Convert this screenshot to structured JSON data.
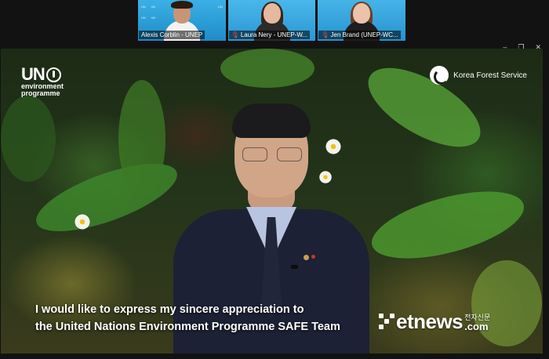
{
  "participants": [
    {
      "name": "Alexis Corblin - UNEP",
      "mic_muted": false
    },
    {
      "name": "Laura Nery - UNEP-W...",
      "mic_muted": true
    },
    {
      "name": "Jen Brand (UNEP-WC...",
      "mic_muted": true
    }
  ],
  "window_controls": {
    "minimize": "–",
    "restore": "❐",
    "close": "✕"
  },
  "video": {
    "logo_left": {
      "main": "UN",
      "line1": "environment",
      "line2": "programme"
    },
    "logo_right": "Korea Forest Service",
    "subtitle_line1": "I would like to express my sincere appreciation to",
    "subtitle_line2": "the United Nations Environment Programme SAFE Team",
    "watermark": {
      "brand": "etnews",
      "korean": "전자신문",
      "domain": ".com"
    }
  },
  "colors": {
    "tile_bg": "#2a9fd9",
    "background": "#121212",
    "mute_icon": "#e24a4a"
  }
}
